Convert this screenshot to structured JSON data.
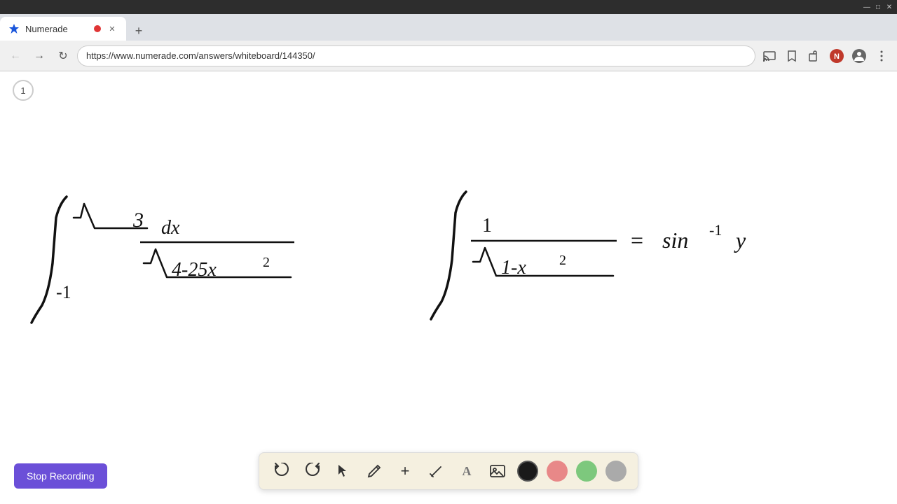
{
  "browser": {
    "title": "Numerade",
    "url": "https://www.numerade.com/answers/whiteboard/144350/",
    "tab_label": "Numerade",
    "new_tab_symbol": "+",
    "nav": {
      "back": "←",
      "forward": "→",
      "refresh": "↺"
    }
  },
  "page": {
    "number": "1"
  },
  "toolbar": {
    "undo": "↺",
    "redo": "↻",
    "select": "▲",
    "pen": "✏",
    "plus": "+",
    "eraser": "/",
    "text": "A",
    "image": "🖼",
    "colors": {
      "black": "#1a1a1a",
      "pink": "#e88888",
      "green": "#7dc87d",
      "gray": "#aaaaaa"
    }
  },
  "stop_recording": {
    "label": "Stop Recording"
  }
}
